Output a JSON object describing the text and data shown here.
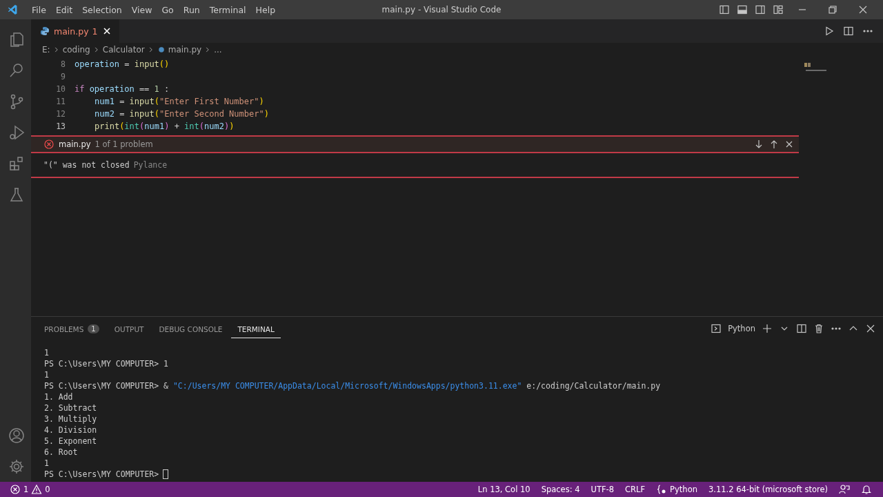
{
  "window": {
    "title": "main.py - Visual Studio Code"
  },
  "menu": [
    "File",
    "Edit",
    "Selection",
    "View",
    "Go",
    "Run",
    "Terminal",
    "Help"
  ],
  "activity_bar": {
    "items": [
      {
        "kind": "files",
        "selected": false
      },
      {
        "kind": "search",
        "selected": false
      },
      {
        "kind": "source-control",
        "selected": false
      },
      {
        "kind": "run-debug",
        "selected": false
      },
      {
        "kind": "extensions",
        "selected": false
      },
      {
        "kind": "testing",
        "selected": false
      }
    ],
    "bottom": [
      {
        "kind": "account"
      },
      {
        "kind": "settings"
      }
    ]
  },
  "tabs": [
    {
      "label": "main.py",
      "badge": "1",
      "selected": true,
      "has_error": true
    }
  ],
  "breadcrumb": [
    "E:",
    "coding",
    "Calculator",
    "main.py",
    "..."
  ],
  "editor": {
    "lines": [
      {
        "number": "8",
        "current": false,
        "tokens": [
          {
            "text": "operation",
            "kind": "variable"
          },
          {
            "text": " = ",
            "kind": "operator"
          },
          {
            "text": "input",
            "kind": "function"
          },
          {
            "text": "()",
            "kind": "bracket"
          }
        ]
      },
      {
        "number": "9",
        "current": false
      },
      {
        "number": "10",
        "current": false,
        "tokens": [
          {
            "text": "if",
            "kind": "keyword",
            "space_after": true
          },
          {
            "text": "operation",
            "kind": "variable"
          },
          {
            "text": " == ",
            "kind": "operator"
          },
          {
            "text": "1",
            "kind": "number"
          },
          {
            "text": " :",
            "kind": "operator"
          }
        ]
      },
      {
        "number": "11",
        "current": false,
        "indented": true,
        "tokens": [
          {
            "text": "num1",
            "kind": "variable"
          },
          {
            "text": " = ",
            "kind": "operator"
          },
          {
            "text": "input",
            "kind": "function"
          },
          {
            "text": "(",
            "kind": "bracket"
          },
          {
            "text": "\"Enter First Number\"",
            "kind": "string"
          },
          {
            "text": ")",
            "kind": "bracket"
          }
        ]
      },
      {
        "number": "12",
        "current": false,
        "indented": true,
        "tokens": [
          {
            "text": "num2",
            "kind": "variable"
          },
          {
            "text": " = ",
            "kind": "operator"
          },
          {
            "text": "input",
            "kind": "function"
          },
          {
            "text": "(",
            "kind": "bracket"
          },
          {
            "text": "\"Enter Second Number\"",
            "kind": "string"
          },
          {
            "text": ")",
            "kind": "bracket"
          }
        ]
      },
      {
        "number": "13",
        "current": true,
        "indented": true,
        "tokens": [
          {
            "text": "print",
            "kind": "function"
          },
          {
            "text": "(",
            "kind": "bracket"
          },
          {
            "text": "int",
            "kind": "class"
          },
          {
            "text": "(",
            "kind": "bracket2"
          },
          {
            "text": "num1",
            "kind": "variable"
          },
          {
            "text": ")",
            "kind": "bracket2"
          },
          {
            "text": " + ",
            "kind": "operator"
          },
          {
            "text": "int",
            "kind": "class"
          },
          {
            "text": "(",
            "kind": "bracket2"
          },
          {
            "text": "num2",
            "kind": "variable"
          },
          {
            "text": ")",
            "kind": "bracket2"
          },
          {
            "text": ")",
            "kind": "bracket"
          }
        ]
      }
    ]
  },
  "peek": {
    "file": "main.py",
    "count": "1 of 1 problem",
    "message": "\"(\" was not closed",
    "source": "Pylance"
  },
  "panel": {
    "tabs": [
      {
        "label": "PROBLEMS",
        "badge": "1",
        "selected": false
      },
      {
        "label": "OUTPUT",
        "selected": false
      },
      {
        "label": "DEBUG CONSOLE",
        "selected": false
      },
      {
        "label": "TERMINAL",
        "selected": true
      }
    ],
    "terminal_name": "Python",
    "terminal": [
      {
        "parts": [
          {
            "text": "1",
            "kind": "plain"
          }
        ]
      },
      {
        "parts": [
          {
            "text": "PS C:\\Users\\MY COMPUTER> 1",
            "kind": "plain"
          }
        ]
      },
      {
        "parts": [
          {
            "text": "1",
            "kind": "plain"
          }
        ]
      },
      {
        "parts": [
          {
            "text": "PS C:\\Users\\MY COMPUTER> & ",
            "kind": "plain"
          },
          {
            "text": "\"C:/Users/MY COMPUTER/AppData/Local/Microsoft/WindowsApps/python3.11.exe\"",
            "kind": "string"
          },
          {
            "text": " e:/coding/Calculator/main.py",
            "kind": "plain"
          }
        ]
      },
      {
        "parts": [
          {
            "text": "1. Add",
            "kind": "plain"
          }
        ]
      },
      {
        "parts": [
          {
            "text": "2. Subtract",
            "kind": "plain"
          }
        ]
      },
      {
        "parts": [
          {
            "text": "3. Multiply",
            "kind": "plain"
          }
        ]
      },
      {
        "parts": [
          {
            "text": "4. Division",
            "kind": "plain"
          }
        ]
      },
      {
        "parts": [
          {
            "text": "5. Exponent",
            "kind": "plain"
          }
        ]
      },
      {
        "parts": [
          {
            "text": "6. Root",
            "kind": "plain"
          }
        ]
      },
      {
        "parts": [
          {
            "text": "1",
            "kind": "plain"
          }
        ]
      },
      {
        "parts": [
          {
            "text": "PS C:\\Users\\MY COMPUTER>",
            "kind": "plain"
          }
        ],
        "cursor": true
      }
    ]
  },
  "status_bar": {
    "errors": "1",
    "warnings": "0",
    "right": [
      {
        "kind": "text",
        "text": "Ln 13, Col 10"
      },
      {
        "kind": "text",
        "text": "Spaces: 4"
      },
      {
        "kind": "text",
        "text": "UTF-8"
      },
      {
        "kind": "text",
        "text": "CRLF"
      },
      {
        "kind": "language",
        "text": "Python"
      },
      {
        "kind": "text",
        "text": "3.11.2 64-bit (microsoft store)"
      },
      {
        "kind": "feedback"
      },
      {
        "kind": "bell"
      }
    ]
  }
}
